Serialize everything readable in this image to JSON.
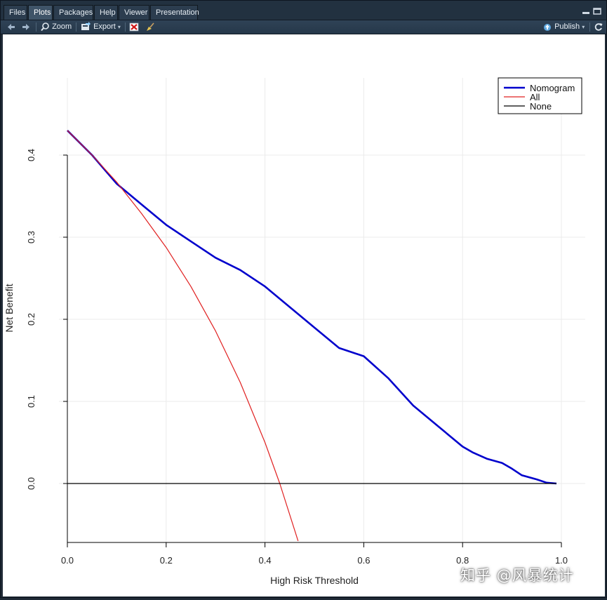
{
  "tabs": [
    {
      "label": "Files",
      "active": false
    },
    {
      "label": "Plots",
      "active": true
    },
    {
      "label": "Packages",
      "active": false
    },
    {
      "label": "Help",
      "active": false
    },
    {
      "label": "Viewer",
      "active": false
    },
    {
      "label": "Presentation",
      "active": false
    }
  ],
  "toolbar": {
    "zoom_label": "Zoom",
    "export_label": "Export",
    "publish_label": "Publish"
  },
  "icons": {
    "back": "arrow-left-icon",
    "forward": "arrow-right-icon",
    "zoom": "magnifier-icon",
    "export": "export-icon",
    "remove": "remove-plot-icon",
    "clear": "broom-icon",
    "publish": "publish-icon",
    "refresh": "refresh-icon"
  },
  "watermark": "知乎 @风暴统计",
  "chart_data": {
    "type": "line",
    "xlabel": "High Risk Threshold",
    "ylabel": "Net Benefit",
    "xlim": [
      0,
      1
    ],
    "ylim": [
      -0.07,
      0.45
    ],
    "xticks": [
      "0.0",
      "0.2",
      "0.4",
      "0.6",
      "0.8",
      "1.0"
    ],
    "yticks": [
      "0.0",
      "0.1",
      "0.2",
      "0.3",
      "0.4"
    ],
    "grid": true,
    "legend_position": "top-right",
    "series": [
      {
        "name": "Nomogram",
        "color": "#0000cc",
        "x": [
          0.0,
          0.05,
          0.1,
          0.15,
          0.2,
          0.25,
          0.3,
          0.35,
          0.4,
          0.45,
          0.5,
          0.55,
          0.6,
          0.65,
          0.7,
          0.75,
          0.8,
          0.82,
          0.85,
          0.88,
          0.9,
          0.92,
          0.95,
          0.97,
          0.99
        ],
        "y": [
          0.43,
          0.4,
          0.365,
          0.34,
          0.315,
          0.295,
          0.275,
          0.26,
          0.24,
          0.215,
          0.19,
          0.165,
          0.155,
          0.128,
          0.095,
          0.07,
          0.045,
          0.038,
          0.03,
          0.025,
          0.018,
          0.01,
          0.005,
          0.001,
          0.0
        ]
      },
      {
        "name": "All",
        "color": "#e02020",
        "x": [
          0.0,
          0.05,
          0.1,
          0.15,
          0.2,
          0.25,
          0.3,
          0.35,
          0.4,
          0.43,
          0.467
        ],
        "y": [
          0.43,
          0.4,
          0.367,
          0.329,
          0.2875,
          0.24,
          0.1857,
          0.1231,
          0.05,
          0.0,
          -0.07
        ]
      },
      {
        "name": "None",
        "color": "#000000",
        "x": [
          0.0,
          0.99
        ],
        "y": [
          0.0,
          0.0
        ]
      }
    ]
  }
}
